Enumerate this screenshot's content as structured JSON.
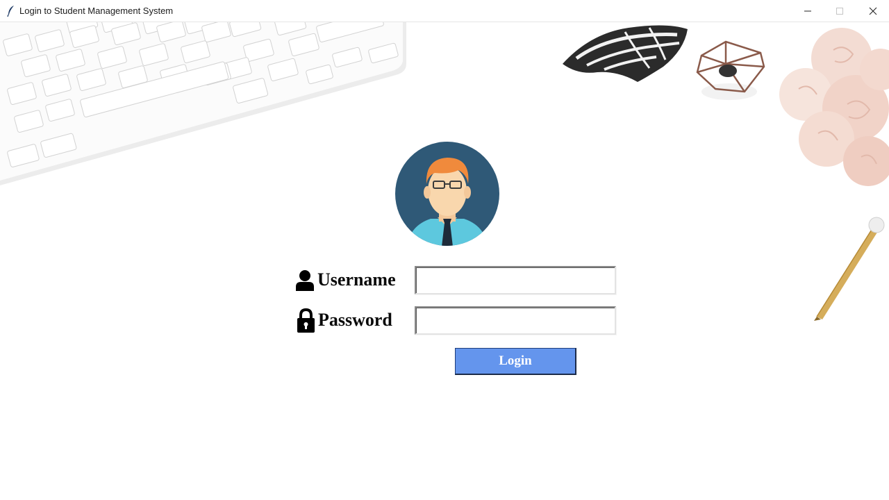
{
  "window": {
    "title": "Login to Student Management System",
    "icon": "feather-icon"
  },
  "form": {
    "username_label": "Username",
    "username_icon": "user-icon",
    "username_value": "",
    "password_label": "Password",
    "password_icon": "lock-icon",
    "password_value": "",
    "login_label": "Login"
  },
  "colors": {
    "login_button": "#6495ed",
    "avatar_background": "#2f5977"
  }
}
